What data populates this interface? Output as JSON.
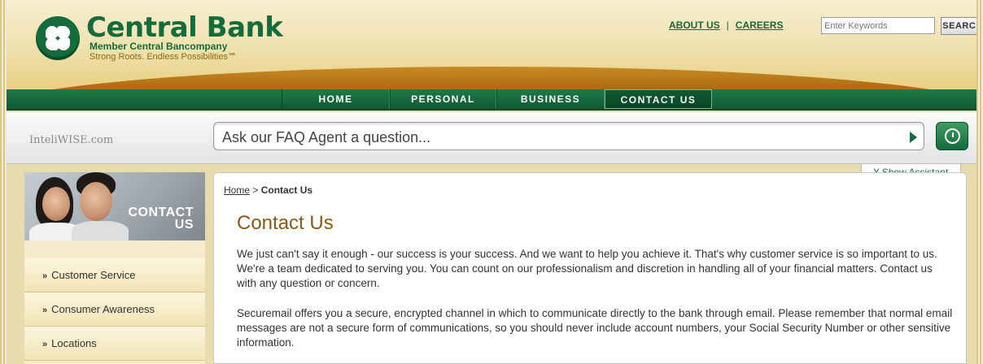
{
  "header": {
    "brand_name": "Central Bank",
    "member": "Member Central Bancompany",
    "tagline": "Strong Roots. Endless Possibilities℠",
    "links": [
      "ABOUT US",
      "CAREERS"
    ],
    "search_placeholder": "Enter Keywords",
    "search_button": "SEARCH"
  },
  "nav": {
    "items": [
      "HOME",
      "PERSONAL",
      "BUSINESS",
      "CONTACT US"
    ],
    "active": "CONTACT US"
  },
  "faq": {
    "powered_by": "InteliWISE.com",
    "placeholder": "Ask our FAQ Agent a question...",
    "show_assistant": "Show Assistant"
  },
  "sidebar": {
    "hero_title_1": "CONTACT",
    "hero_title_2": "US",
    "items": [
      "Customer Service",
      "Consumer Awareness",
      "Locations"
    ]
  },
  "breadcrumb": {
    "home": "Home",
    "separator": ">",
    "current": "Contact Us"
  },
  "main": {
    "title": "Contact Us",
    "paragraphs": [
      "We just can't say it enough - our success is your success. And we want to help you achieve it. That's why customer service is so important to us. We're a team dedicated to serving you. You can count on our professionalism and discretion in handling all of your financial matters. Contact us with any question or concern.",
      "Securemail offers you a secure, encrypted channel in which to communicate directly to the bank through email. Please remember that normal email messages are not a secure form of communications, so you should never include account numbers, your Social Security Number or other sensitive information."
    ]
  },
  "colors": {
    "brand_green": "#146b3b",
    "gold": "#b06f14",
    "title_brown": "#8a5a12"
  }
}
